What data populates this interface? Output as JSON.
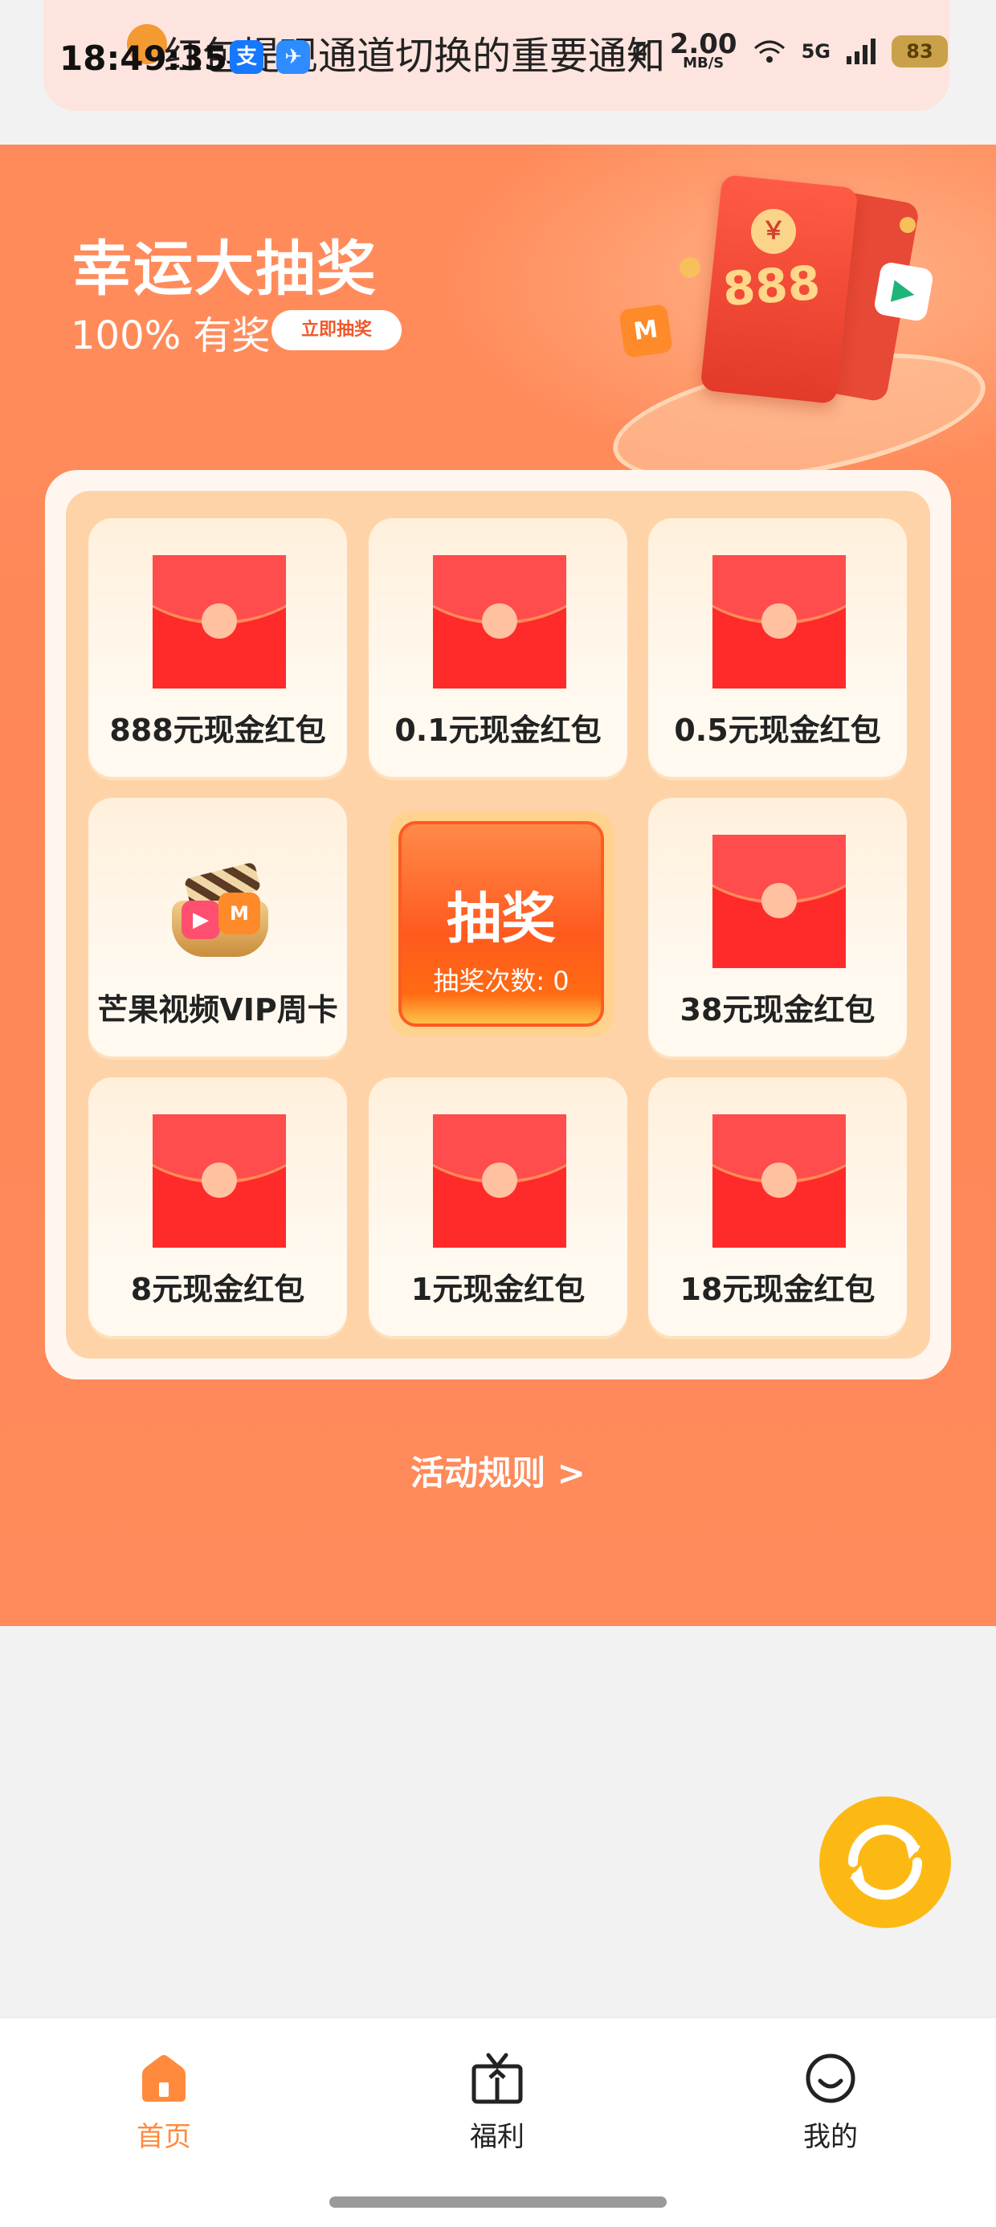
{
  "status_bar": {
    "time": "18:49:35",
    "notification": "红包提现通道切换的重要通知",
    "app_badges": [
      "支",
      "✈"
    ],
    "network_speed": "2.00",
    "network_speed_unit": "MB/S",
    "network_type": "5G",
    "battery": "83"
  },
  "hero": {
    "title": "幸运大抽奖",
    "subtitle": "100% 有奖",
    "cta_label": "立即抽奖",
    "illustration_text": "888"
  },
  "lottery": {
    "prizes": [
      {
        "label": "888元现金红包",
        "type": "red-envelope"
      },
      {
        "label": "0.1元现金红包",
        "type": "red-envelope"
      },
      {
        "label": "0.5元现金红包",
        "type": "red-envelope"
      },
      {
        "label": "芒果视频VIP周卡",
        "type": "vip-card"
      },
      {
        "label": "38元现金红包",
        "type": "red-envelope"
      },
      {
        "label": "8元现金红包",
        "type": "red-envelope"
      },
      {
        "label": "1元现金红包",
        "type": "red-envelope"
      },
      {
        "label": "18元现金红包",
        "type": "red-envelope"
      }
    ],
    "draw_button": {
      "label": "抽奖",
      "count_text": "抽奖次数: 0"
    }
  },
  "rules_link": "活动规则 >",
  "bottom_nav": {
    "items": [
      {
        "label": "首页",
        "icon": "home-icon",
        "active": true
      },
      {
        "label": "福利",
        "icon": "tv-gift-icon",
        "active": false
      },
      {
        "label": "我的",
        "icon": "smile-profile-icon",
        "active": false
      }
    ]
  },
  "colors": {
    "hero_bg": "#ff8a5b",
    "accent": "#ff8a3d",
    "draw_button": "#ff5a1e",
    "refresh_button": "#fdb913"
  }
}
